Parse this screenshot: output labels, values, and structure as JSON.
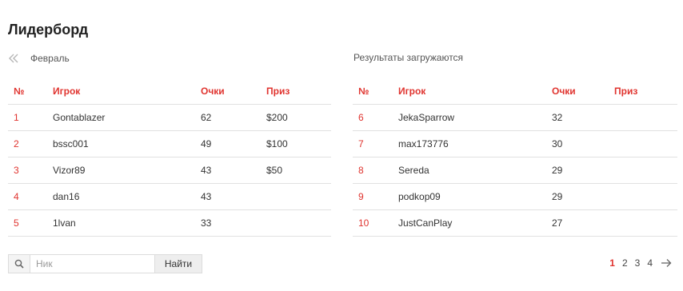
{
  "leaderboard": {
    "title": "Лидерборд",
    "month": "Февраль",
    "status": "Результаты загружаются",
    "columns": {
      "rank": "№",
      "player": "Игрок",
      "points": "Очки",
      "prize": "Приз"
    },
    "left_rows": [
      {
        "rank": "1",
        "player": "Gontablazer",
        "points": "62",
        "prize": "$200"
      },
      {
        "rank": "2",
        "player": "bssc001",
        "points": "49",
        "prize": "$100"
      },
      {
        "rank": "3",
        "player": "Vizor89",
        "points": "43",
        "prize": "$50"
      },
      {
        "rank": "4",
        "player": "dan16",
        "points": "43",
        "prize": ""
      },
      {
        "rank": "5",
        "player": "1lvan",
        "points": "33",
        "prize": ""
      }
    ],
    "right_rows": [
      {
        "rank": "6",
        "player": "JekaSparrow",
        "points": "32",
        "prize": ""
      },
      {
        "rank": "7",
        "player": "max173776",
        "points": "30",
        "prize": ""
      },
      {
        "rank": "8",
        "player": "Sereda",
        "points": "29",
        "prize": ""
      },
      {
        "rank": "9",
        "player": "podkop09",
        "points": "29",
        "prize": ""
      },
      {
        "rank": "10",
        "player": "JustCanPlay",
        "points": "27",
        "prize": ""
      }
    ]
  },
  "search": {
    "placeholder": "Ник",
    "button_label": "Найти"
  },
  "pagination": {
    "pages": [
      "1",
      "2",
      "3",
      "4"
    ],
    "current": "1"
  },
  "colors": {
    "accent": "#e0342f",
    "divider": "#e1e1e1",
    "text": "#333333"
  },
  "icons": {
    "prev": "double-chevron-left-icon",
    "search": "search-icon",
    "next": "arrow-right-icon"
  }
}
